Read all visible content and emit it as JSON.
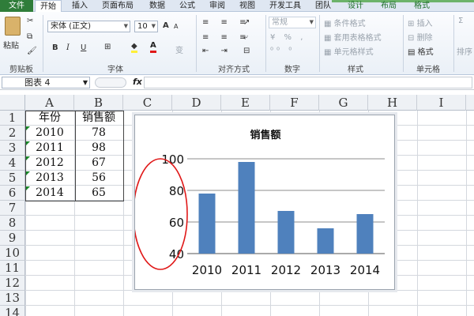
{
  "ribbon_tabs": [
    "文件",
    "开始",
    "插入",
    "页面布局",
    "数据",
    "公式",
    "审阅",
    "视图",
    "开发工具",
    "团队",
    "设计",
    "布局",
    "格式"
  ],
  "clipboard": {
    "paste": "粘贴",
    "label": "剪贴板"
  },
  "font": {
    "name": "宋体 (正文)",
    "size": "10",
    "bold": "B",
    "italic": "I",
    "underline": "U",
    "grow": "A",
    "shrink": "A",
    "label": "字体"
  },
  "alignment": {
    "label": "对齐方式"
  },
  "number": {
    "format": "常规",
    "label": "数字"
  },
  "styles": {
    "conditional": "条件格式",
    "table": "套用表格格式",
    "cell_styles": "单元格样式",
    "label": "样式"
  },
  "cells_group": {
    "insert": "插入",
    "delete": "删除",
    "format": "格式",
    "label": "单元格"
  },
  "editing": {
    "sigma": "Σ",
    "sort": "排序"
  },
  "formula_bar": {
    "name_box": "图表 4",
    "fx": "fx",
    "formula": ""
  },
  "columns": [
    "A",
    "B",
    "C",
    "D",
    "E",
    "F",
    "G",
    "H",
    "I"
  ],
  "rows": [
    "1",
    "2",
    "3",
    "4",
    "5",
    "6",
    "7",
    "8",
    "9",
    "10",
    "11",
    "12",
    "13",
    "14"
  ],
  "table": {
    "headers": [
      "年份",
      "销售额"
    ],
    "rows": [
      [
        "2010",
        "78"
      ],
      [
        "2011",
        "98"
      ],
      [
        "2012",
        "67"
      ],
      [
        "2013",
        "56"
      ],
      [
        "2014",
        "65"
      ]
    ]
  },
  "chart_data": {
    "type": "bar",
    "title": "销售额",
    "categories": [
      "2010",
      "2011",
      "2012",
      "2013",
      "2014"
    ],
    "values": [
      78,
      98,
      67,
      56,
      65
    ],
    "ylim": [
      40,
      100
    ],
    "yticks": [
      "40",
      "60",
      "80",
      "100"
    ],
    "grid": true,
    "legend": "none",
    "bar_color": "#4f81bd",
    "annotation_color": "#e01818"
  },
  "colors": {
    "file_tab": "#2f7d3a",
    "ribbon": "#eaf0f7",
    "bar": "#4f81bd",
    "annotation": "#e01818"
  }
}
